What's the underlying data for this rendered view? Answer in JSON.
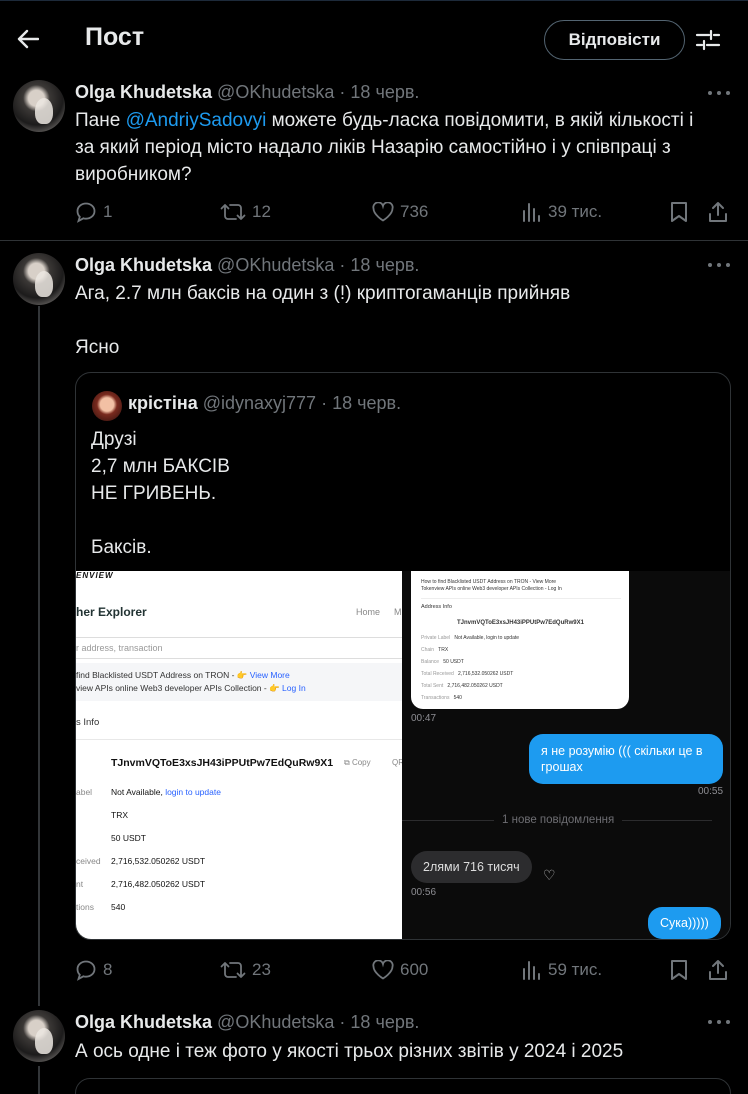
{
  "header": {
    "title": "Пост",
    "reply_button": "Відповісти",
    "back_icon": "arrow-left-icon",
    "filter_icon": "sliders-icon"
  },
  "tweets": [
    {
      "name": "Olga Khudetska",
      "handle": "@OKhudetska",
      "dot": "·",
      "date": "18 черв.",
      "text_prefix": "Пане ",
      "mention": "@AndriySadovyi",
      "text_lines": [
        " можете будь-ласка повідомити, в якій кількості і",
        "за який період місто надало ліків Назарію самостійно і у співпраці з",
        "виробником?"
      ],
      "replies": "1",
      "reposts": "12",
      "likes": "736",
      "views": "39 тис."
    },
    {
      "name": "Olga Khudetska",
      "handle": "@OKhudetska",
      "dot": "·",
      "date": "18 черв.",
      "text_line1": "Ага, 2.7 млн баксів на один з (!) криптогаманців прийняв",
      "text_line2": "Ясно",
      "replies": "8",
      "reposts": "23",
      "likes": "600",
      "views": "59 тис.",
      "quote": {
        "name": "крістіна",
        "handle": "@idynaxyj777",
        "dot": "·",
        "date": "18 черв.",
        "text": "Друзі\n2,7 млн БАКСІВ\nНЕ ГРИВЕНЬ.\n\nБаксів.",
        "explorer": {
          "logo": "ENVIEW",
          "brand": "her Explorer",
          "nav_home": "Home",
          "nav_m": "M",
          "search_placeholder": "r address, transaction",
          "link1_prefix": " find Blacklisted USDT Address on TRON - ",
          "link1_link": "View More",
          "link2_prefix": "view APIs online Web3 developer APIs Collection - ",
          "link2_link": "Log In",
          "section": "s Info",
          "address": "TJnvmVQToE3xsJH43iPPUtPw7EdQuRw9X1",
          "copy": "Copy",
          "qr": "QR",
          "rows": [
            {
              "label": "abel",
              "value": "Not Available, ",
              "link": "login to update"
            },
            {
              "label": "",
              "value": "TRX",
              "link": ""
            },
            {
              "label": "",
              "value": "50 USDT",
              "link": ""
            },
            {
              "label": "ceived",
              "value": "2,716,532.050262 USDT",
              "link": ""
            },
            {
              "label": "nt",
              "value": "2,716,482.050262 USDT",
              "link": ""
            },
            {
              "label": "tions",
              "value": "540",
              "link": ""
            }
          ]
        },
        "chat": {
          "img_line1": "How to find Blacklisted USDT Address on TRON - View More",
          "img_line2": "Tokenview APIs online Web3 developer APIs Collection - Log In",
          "img_section": "Address Info",
          "img_addr": "TJnvmVQToE3xsJH43iPPUtPw7EdQuRw9X1",
          "img_rows": [
            {
              "label": "Private Label",
              "value": "Not Available, login to update"
            },
            {
              "label": "Chain",
              "value": "TRX"
            },
            {
              "label": "Balance",
              "value": "50 USDT"
            },
            {
              "label": "Total Received",
              "value": "2,716,532.050262 USDT"
            },
            {
              "label": "Total Sent",
              "value": "2,716,482.050262 USDT"
            },
            {
              "label": "Transactions",
              "value": "540"
            }
          ],
          "time1": "00:47",
          "out1": "я не розумію ((( скільки це в грошах",
          "time2": "00:55",
          "new_messages": "1 нове повідомлення",
          "in1": "2лями  716 тисяч",
          "time3": "00:56",
          "out2": "Сука)))))"
        }
      }
    },
    {
      "name": "Olga Khudetska",
      "handle": "@OKhudetska",
      "dot": "·",
      "date": "18 черв.",
      "text": "А ось одне і теж фото у якості трьох різних звітів у 2024 і 2025"
    }
  ],
  "colors": {
    "background": "#000000",
    "accent": "#1d9bf0",
    "muted": "#71767b",
    "text": "#e7e9ea"
  }
}
